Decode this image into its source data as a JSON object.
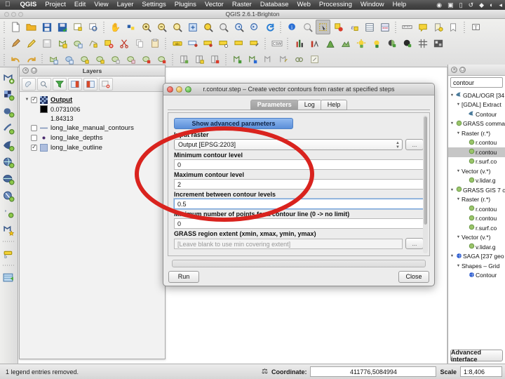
{
  "macbar": {
    "apple_icon": "apple-logo",
    "menus": [
      "QGIS",
      "Project",
      "Edit",
      "View",
      "Layer",
      "Settings",
      "Plugins",
      "Vector",
      "Raster",
      "Database",
      "Web",
      "Processing",
      "Window",
      "Help"
    ],
    "sys_icons": [
      "dropbox-icon",
      "displays-icon",
      "screen-icon",
      "timemachine-icon",
      "bluetooth-icon",
      "wifi-icon",
      "volume-icon"
    ]
  },
  "window": {
    "title": "QGIS 2.6.1-Brighton"
  },
  "toolbars": {
    "row1": [
      "new-project-icon",
      "open-project-icon",
      "save-project-icon",
      "save-project-as-icon",
      "new-print-composer-icon",
      "composer-manager-icon",
      "pan-map-icon",
      "pan-to-selection-icon",
      "zoom-in-icon",
      "zoom-out-icon",
      "zoom-native-icon",
      "zoom-full-icon",
      "zoom-to-selection-icon",
      "zoom-to-layer-icon",
      "zoom-last-icon",
      "zoom-next-icon",
      "refresh-icon",
      "identify-features-icon",
      "measure-icon",
      "select-features-icon",
      "deselect-icon",
      "select-expression-icon",
      "open-attribute-table-icon",
      "field-calculator-icon",
      "measure-line-icon",
      "map-tips-icon",
      "new-bookmark-icon",
      "show-bookmarks-icon",
      "text-annotation-icon"
    ],
    "row2": [
      "current-edits-icon",
      "toggle-editing-icon",
      "save-layer-edits-icon",
      "add-feature-icon",
      "move-feature-icon",
      "node-tool-icon",
      "delete-selected-icon",
      "cut-features-icon",
      "copy-features-icon",
      "paste-features-icon",
      "label-icon",
      "pin-labels-icon",
      "show-hide-labels-icon",
      "move-label-icon",
      "rotate-label-icon",
      "change-label-icon",
      "csw-icon",
      "histogram-icon",
      "raster-calc-icon",
      "profile-icon",
      "terrain-icon",
      "light-icon",
      "shadow-icon",
      "hillshade-icon",
      "slope-icon",
      "grid-icon",
      "georeferencer-icon"
    ],
    "row3": [
      "undo-icon",
      "redo-icon",
      "add-vector-layer-icon",
      "add-raster-layer-icon",
      "add-postgis-layer-icon",
      "add-spatialite-layer-icon",
      "add-mssql-layer-icon",
      "add-oracle-layer-icon",
      "add-wms-layer-icon",
      "add-wcs-layer-icon",
      "add-wfs-layer-icon",
      "new-shapefile-icon",
      "new-spatialite-icon",
      "db-manager-icon",
      "new-memory-layer-icon",
      "plugin-manager-icon",
      "python-console-icon",
      "open-table-icon",
      "edit-table-icon"
    ]
  },
  "leftbar": {
    "icons": [
      "add-vector-layer-icon",
      "add-raster-layer-icon",
      "add-postgis-layer-icon",
      "add-spatialite-layer-icon",
      "add-mssql-layer-icon",
      "add-wms-layer-icon",
      "add-wcs-layer-icon",
      "add-wfs-layer-icon",
      "add-delimited-text-icon",
      "add-openstreetmap-icon",
      "new-shapefile-layer-icon",
      "db-manager-icon"
    ]
  },
  "layers_panel": {
    "title": "Layers",
    "close_btn": "close-panel-icon",
    "float_btn": "float-panel-icon",
    "tools": [
      "style-manager-icon",
      "filter-legend-icon",
      "filter-legend-expression-icon",
      "expand-all-icon",
      "collapse-all-icon",
      "remove-layer-icon"
    ],
    "items": [
      {
        "label": "Output",
        "checked": true,
        "selected": true,
        "symbol": "raster-icon",
        "expanded": true,
        "children": [
          {
            "label": "0.0731006",
            "swatch": "#000000",
            "kind": "raster-min-value"
          },
          {
            "label": "1.84313",
            "swatch": "",
            "kind": "raster-max-value"
          }
        ]
      },
      {
        "label": "long_lake_manual_contours",
        "checked": false,
        "selected": false,
        "symbol": "line-symbol",
        "symbol_color": "#7a8fb8"
      },
      {
        "label": "long_lake_depths",
        "checked": false,
        "selected": false,
        "symbol": "point-symbol",
        "symbol_color": "#4b2a6e"
      },
      {
        "label": "long_lake_outline",
        "checked": true,
        "selected": false,
        "symbol": "polygon-symbol",
        "symbol_color": "#aebede"
      }
    ]
  },
  "toolbox": {
    "search_value": "contour",
    "advanced_button": "Advanced interface",
    "tree": [
      {
        "depth": 0,
        "label": "GDAL/OGR [34",
        "icon": "gdal-icon",
        "twisty": "▼"
      },
      {
        "depth": 1,
        "label": "[GDAL] Extract",
        "icon": "",
        "twisty": "▼"
      },
      {
        "depth": 2,
        "label": "Contour",
        "icon": "gdal-icon",
        "twisty": ""
      },
      {
        "depth": 0,
        "label": "GRASS commar",
        "icon": "grass-icon",
        "twisty": "▼"
      },
      {
        "depth": 1,
        "label": "Raster (r.*)",
        "icon": "",
        "twisty": "▼"
      },
      {
        "depth": 2,
        "label": "r.contou",
        "icon": "grass-icon",
        "twisty": ""
      },
      {
        "depth": 2,
        "label": "r.contou",
        "icon": "grass-icon",
        "twisty": "",
        "highlighted": true
      },
      {
        "depth": 2,
        "label": "r.surf.co",
        "icon": "grass-icon",
        "twisty": ""
      },
      {
        "depth": 1,
        "label": "Vector (v.*)",
        "icon": "",
        "twisty": "▼"
      },
      {
        "depth": 2,
        "label": "v.lidar.g",
        "icon": "grass-icon",
        "twisty": ""
      },
      {
        "depth": 0,
        "label": "GRASS GIS 7 co",
        "icon": "grass-icon",
        "twisty": "▼"
      },
      {
        "depth": 1,
        "label": "Raster (r.*)",
        "icon": "",
        "twisty": "▼"
      },
      {
        "depth": 2,
        "label": "r.contou",
        "icon": "grass-icon",
        "twisty": ""
      },
      {
        "depth": 2,
        "label": "r.contou",
        "icon": "grass-icon",
        "twisty": ""
      },
      {
        "depth": 2,
        "label": "r.surf.co",
        "icon": "grass-icon",
        "twisty": ""
      },
      {
        "depth": 1,
        "label": "Vector (v.*)",
        "icon": "",
        "twisty": "▼"
      },
      {
        "depth": 2,
        "label": "v.lidar.g",
        "icon": "grass-icon",
        "twisty": ""
      },
      {
        "depth": 0,
        "label": "SAGA [237 geo",
        "icon": "saga-icon",
        "twisty": "▼"
      },
      {
        "depth": 1,
        "label": "Shapes – Grid",
        "icon": "",
        "twisty": "▼"
      },
      {
        "depth": 2,
        "label": "Contour",
        "icon": "saga-icon",
        "twisty": ""
      }
    ]
  },
  "dialog": {
    "title": "r.contour.step – Create vector contours from raster at specified steps",
    "lights": [
      "close-button",
      "minimize-button",
      "zoom-button"
    ],
    "tabs": [
      {
        "label": "Parameters",
        "active": true
      },
      {
        "label": "Log",
        "active": false
      },
      {
        "label": "Help",
        "active": false
      }
    ],
    "advanced_params_button": "Show advanced parameters",
    "fields": [
      {
        "label": "Input raster",
        "value": "Output [EPSG:2203]",
        "type": "combo",
        "browse": "..."
      },
      {
        "label": "Minimum contour level",
        "value": "0",
        "type": "text"
      },
      {
        "label": "Maximum contour level",
        "value": "2",
        "type": "text"
      },
      {
        "label": "Increment between contour levels",
        "value": "0.5",
        "type": "text",
        "focused": true
      },
      {
        "label": "Minimum number of points for a contour line (0 -> no limit)",
        "value": "0",
        "type": "text"
      },
      {
        "label": "GRASS region extent (xmin, xmax, ymin, ymax)",
        "value": "[Leave blank to use min covering extent]",
        "type": "text",
        "placeholder": true,
        "browse": "..."
      }
    ],
    "run_button": "Run",
    "close_button": "Close"
  },
  "annotation": {
    "shape": "ellipse",
    "color": "#d9231e"
  },
  "statusbar": {
    "message": "1 legend entries removed.",
    "render_icon": "render-toggle-icon",
    "coordinate_label": "Coordinate:",
    "coordinate_value": "411776,5084994",
    "scale_label": "Scale",
    "scale_value": "1:8,406"
  }
}
